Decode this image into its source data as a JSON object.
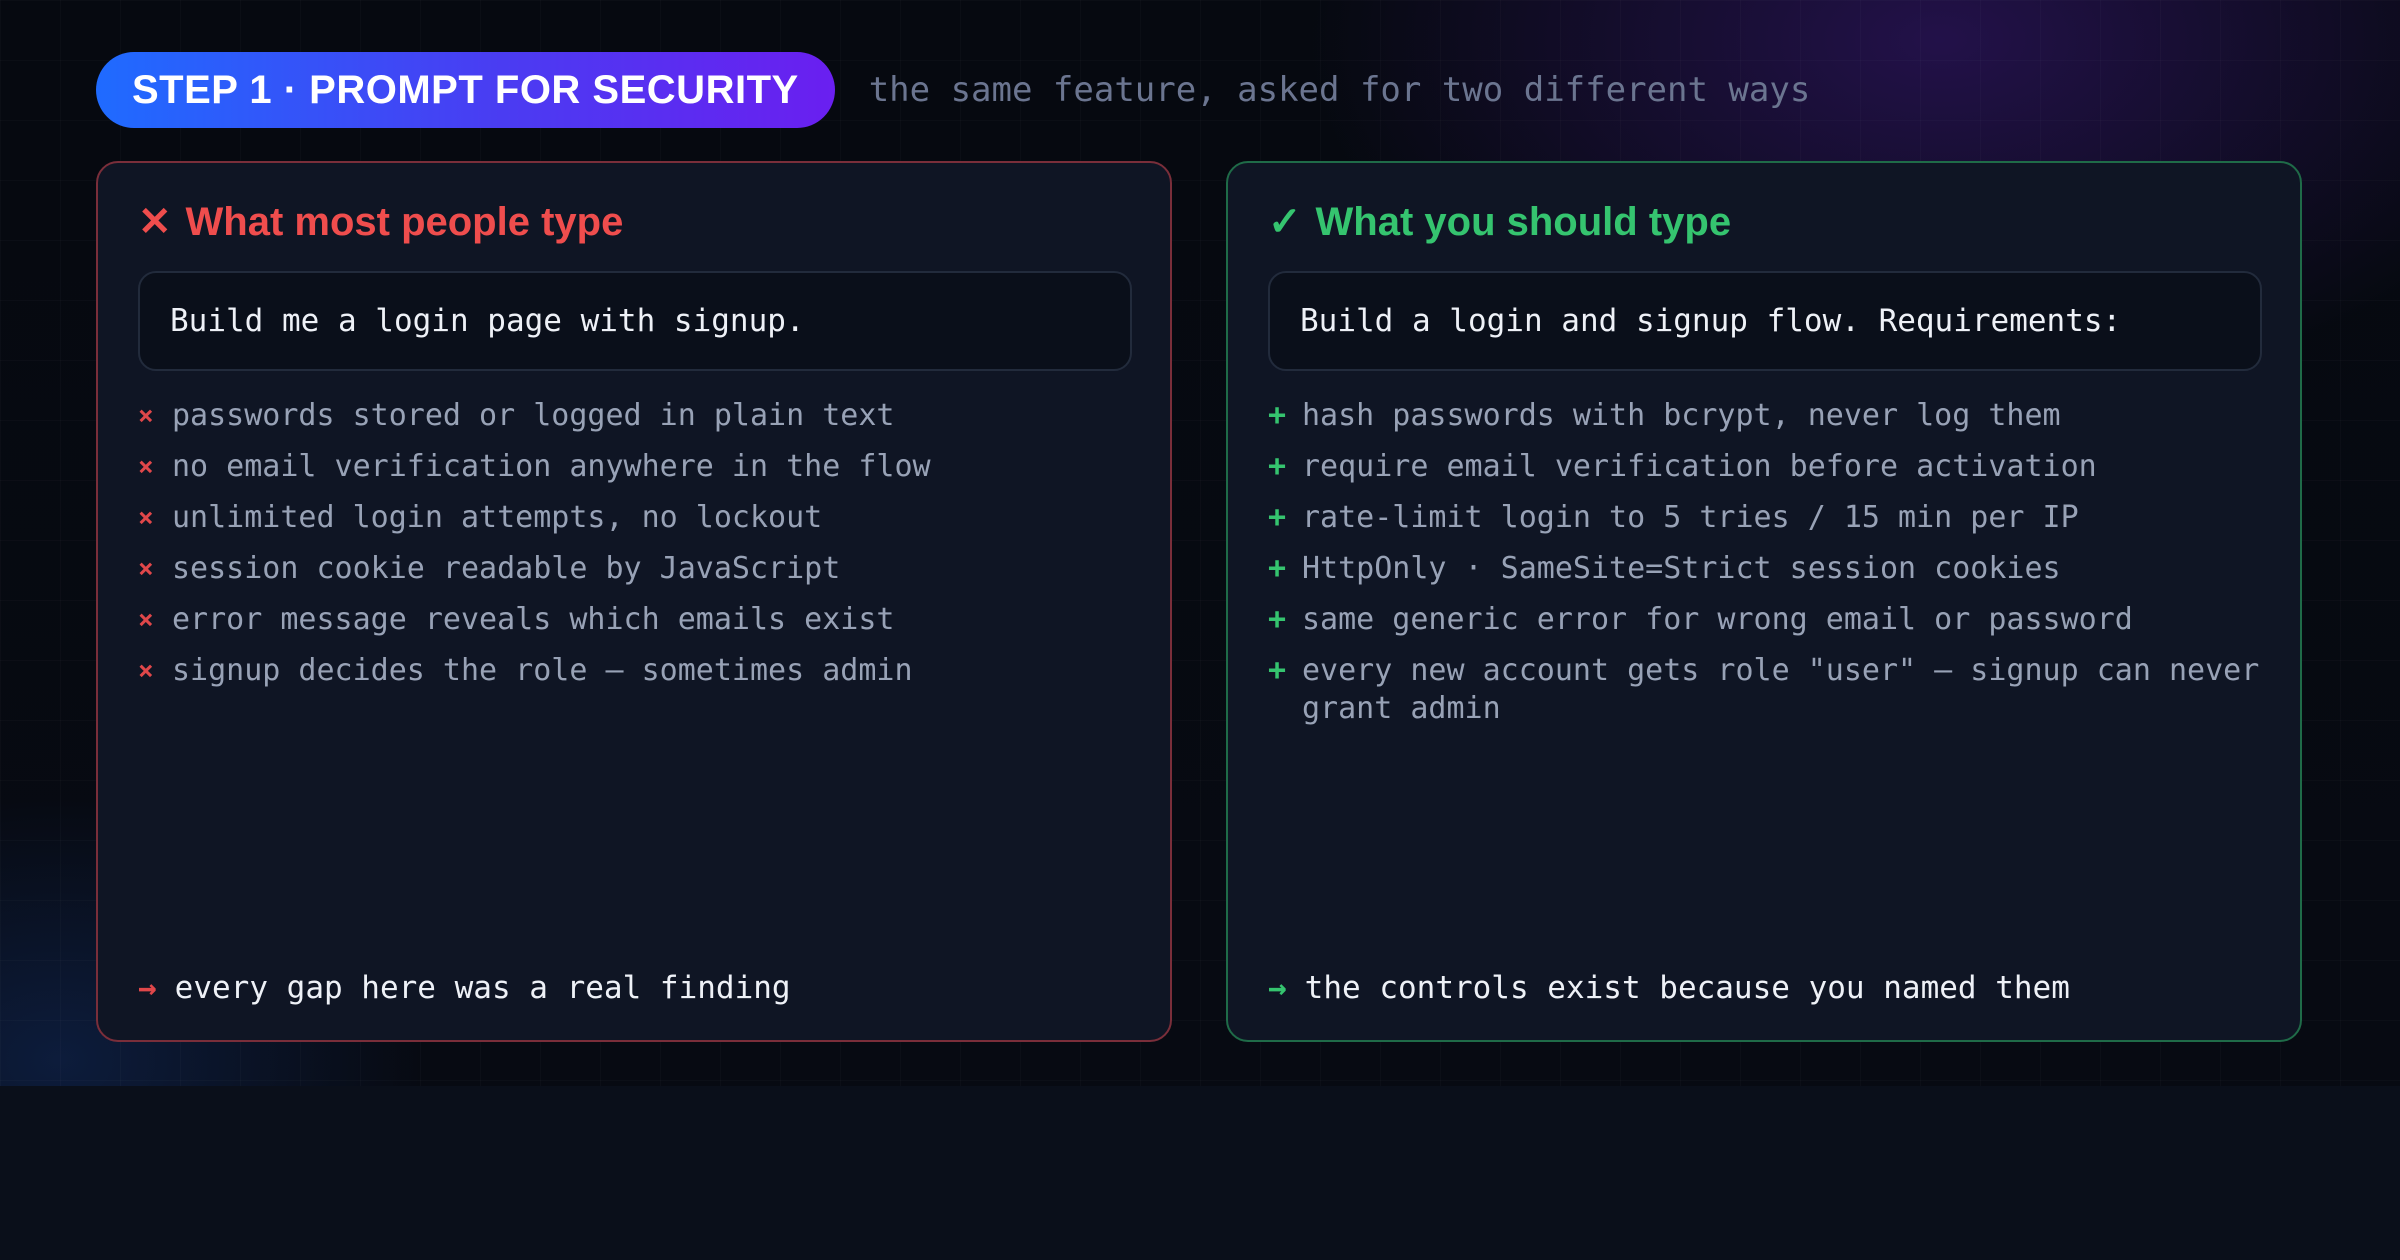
{
  "header": {
    "step_label": "STEP 1 · PROMPT FOR SECURITY",
    "subtitle": "the same feature, asked for two different ways"
  },
  "bad_panel": {
    "icon": "✕",
    "title": "What most people type",
    "prompt": "Build me a login page with signup.",
    "mark": "×",
    "items": [
      "passwords stored or logged in plain text",
      "no email verification anywhere in the flow",
      "unlimited login attempts, no lockout",
      "session cookie readable by JavaScript",
      "error message reveals which emails exist",
      "signup decides the role — sometimes admin"
    ],
    "footer_arrow": "→",
    "footer": "every gap here was a real finding",
    "accent": "#ef4d4d"
  },
  "good_panel": {
    "icon": "✓",
    "title": "What you should type",
    "prompt": "Build a login and signup flow. Requirements:",
    "mark": "+",
    "items": [
      "hash passwords with bcrypt, never log them",
      "require email verification before activation",
      "rate-limit login to 5 tries / 15 min per IP",
      "HttpOnly · SameSite=Strict session cookies",
      "same generic error for wrong email or password",
      "every new account gets role \"user\" — signup can never grant admin"
    ],
    "footer_arrow": "→",
    "footer": "the controls exist because you named them",
    "accent": "#35c46f"
  }
}
